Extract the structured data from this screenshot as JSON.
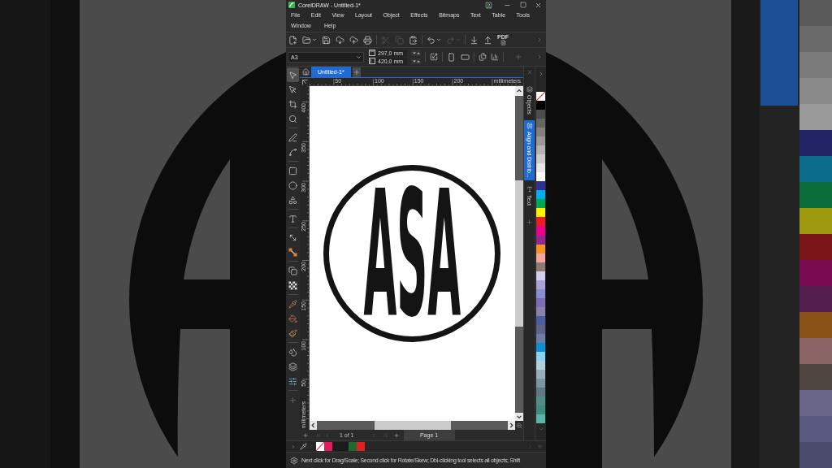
{
  "window": {
    "title": "CorelDRAW - Untitled-1*"
  },
  "menu_rows": [
    [
      "File",
      "Edit",
      "View",
      "Layout",
      "Object",
      "Effects",
      "Bitmaps",
      "Text",
      "Table",
      "Tools"
    ],
    [
      "Window",
      "Help"
    ]
  ],
  "toolbar": [
    [
      {
        "kind": "new",
        "disabled": false,
        "dropdown": false
      },
      {
        "kind": "open",
        "disabled": false,
        "dropdown": true
      },
      {
        "kind": "save",
        "disabled": false,
        "dropdown": false
      },
      {
        "kind": "download",
        "disabled": false,
        "dropdown": false
      },
      {
        "kind": "upload",
        "disabled": false,
        "dropdown": false
      },
      {
        "kind": "print",
        "disabled": false,
        "dropdown": false
      }
    ],
    [
      {
        "kind": "cut",
        "disabled": true,
        "dropdown": false
      },
      {
        "kind": "copy",
        "disabled": true,
        "dropdown": false
      },
      {
        "kind": "paste",
        "disabled": false,
        "dropdown": false
      }
    ],
    [
      {
        "kind": "undo",
        "disabled": false,
        "dropdown": true
      },
      {
        "kind": "redo",
        "disabled": true,
        "dropdown": true
      }
    ],
    [
      {
        "kind": "import",
        "disabled": false,
        "dropdown": false
      },
      {
        "kind": "export",
        "disabled": false,
        "dropdown": false
      },
      {
        "kind": "pdf",
        "label": "PDF",
        "disabled": false,
        "dropdown": false
      }
    ]
  ],
  "property_bar": {
    "page_size": "A3",
    "page_width": "297,0 mm",
    "page_height": "420,0 mm"
  },
  "document_tabs": [
    {
      "label": "Untitled-1*",
      "selected": true
    }
  ],
  "toolbox": [
    [
      {
        "kind": "pick",
        "selected": true
      },
      {
        "kind": "shape",
        "selected": false
      },
      {
        "kind": "crop",
        "selected": false
      },
      {
        "kind": "zoom",
        "selected": false
      }
    ],
    [
      {
        "kind": "freehand",
        "selected": false
      },
      {
        "kind": "curve",
        "selected": false
      }
    ],
    [
      {
        "kind": "rectangle",
        "selected": false
      },
      {
        "kind": "ellipse",
        "selected": false
      },
      {
        "kind": "polygon",
        "selected": false
      }
    ],
    [
      {
        "kind": "text",
        "selected": false
      }
    ],
    [
      {
        "kind": "dimension",
        "selected": false
      },
      {
        "kind": "connector",
        "selected": false
      }
    ],
    [
      {
        "kind": "shadow",
        "selected": false
      },
      {
        "kind": "transparency",
        "selected": false
      }
    ],
    [
      {
        "kind": "eyedropper",
        "selected": false
      },
      {
        "kind": "fill",
        "selected": false
      },
      {
        "kind": "interactive_fill",
        "selected": false
      }
    ],
    [
      {
        "kind": "smart_fill",
        "selected": false
      },
      {
        "kind": "bitmap",
        "selected": false
      },
      {
        "kind": "adjust",
        "selected": false
      }
    ],
    [
      {
        "kind": "add",
        "selected": false
      }
    ]
  ],
  "top_ruler": {
    "labels": [
      "50",
      "100",
      "150",
      "200"
    ],
    "unit": "millimeters"
  },
  "left_ruler": {
    "labels": [
      "400",
      "350",
      "300",
      "250",
      "200",
      "150",
      "100",
      "50"
    ],
    "unit": "millimeters"
  },
  "canvas": {
    "monogram": "ASA"
  },
  "page_nav": {
    "counter": "1 of 1",
    "pages": [
      {
        "label": "Page 1",
        "selected": true
      }
    ]
  },
  "dockers": [
    {
      "kind": "objects",
      "label": "Objects",
      "selected": false
    },
    {
      "kind": "align",
      "label": "Align and Distrib...",
      "selected": true
    },
    {
      "kind": "text",
      "label": "Text",
      "selected": false
    }
  ],
  "palette": [
    {
      "kind": "none"
    },
    {
      "kind": "swatch",
      "color": "#000000"
    },
    {
      "kind": "swatch",
      "color": "#4d4d4d"
    },
    {
      "kind": "swatch",
      "color": "#666666"
    },
    {
      "kind": "swatch",
      "color": "#808080"
    },
    {
      "kind": "swatch",
      "color": "#999999"
    },
    {
      "kind": "swatch",
      "color": "#b3b3b3"
    },
    {
      "kind": "swatch",
      "color": "#cccccc"
    },
    {
      "kind": "swatch",
      "color": "#e6e6e6"
    },
    {
      "kind": "swatch",
      "color": "#ffffff"
    },
    {
      "kind": "swatch",
      "color": "#2e3192"
    },
    {
      "kind": "swatch",
      "color": "#00aeef"
    },
    {
      "kind": "swatch",
      "color": "#00a651"
    },
    {
      "kind": "swatch",
      "color": "#fff200"
    },
    {
      "kind": "swatch",
      "color": "#ed1c24"
    },
    {
      "kind": "swatch",
      "color": "#ec008c"
    },
    {
      "kind": "swatch",
      "color": "#92278f"
    },
    {
      "kind": "swatch",
      "color": "#f7941d"
    },
    {
      "kind": "swatch",
      "color": "#f5a3a3"
    },
    {
      "kind": "swatch",
      "color": "#8c7b70"
    },
    {
      "kind": "swatch",
      "color": "#d4cdec"
    },
    {
      "kind": "swatch",
      "color": "#aaa3d8"
    },
    {
      "kind": "swatch",
      "color": "#8b8fd1"
    },
    {
      "kind": "swatch",
      "color": "#7a6cb5"
    },
    {
      "kind": "swatch",
      "color": "#8b81ad"
    },
    {
      "kind": "swatch",
      "color": "#4b5f9e"
    },
    {
      "kind": "swatch",
      "color": "#5d6389"
    },
    {
      "kind": "swatch",
      "color": "#6d7da6"
    },
    {
      "kind": "swatch",
      "color": "#0d8fd6"
    },
    {
      "kind": "swatch",
      "color": "#86d3f2"
    },
    {
      "kind": "swatch",
      "color": "#b2cfdc"
    },
    {
      "kind": "swatch",
      "color": "#97aebb"
    },
    {
      "kind": "swatch",
      "color": "#7c95a2"
    },
    {
      "kind": "swatch",
      "color": "#5e7884"
    },
    {
      "kind": "swatch",
      "color": "#4f8d86"
    },
    {
      "kind": "swatch",
      "color": "#3e8d80"
    },
    {
      "kind": "swatch",
      "color": "#5bb5a5"
    }
  ],
  "document_palette": [
    {
      "kind": "none"
    },
    {
      "kind": "swatch",
      "color": "#e3195b"
    },
    {
      "kind": "swatch",
      "color": "#1b1b1b"
    },
    {
      "kind": "swatch",
      "color": "#1b1b1b"
    },
    {
      "kind": "swatch",
      "color": "#1e6b2d"
    },
    {
      "kind": "swatch",
      "color": "#e0201f"
    }
  ],
  "status_bar": {
    "text": "Next click for Drag/Scale; Second click for Rotate/Skew; Dbl-clicking tool selects all objects; Shift"
  }
}
